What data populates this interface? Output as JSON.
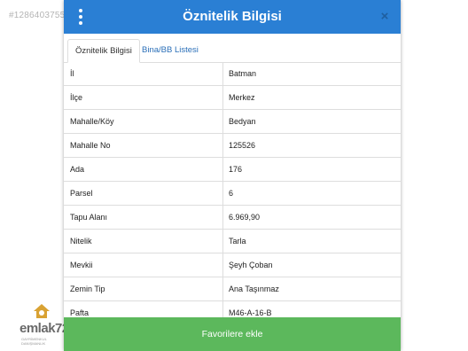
{
  "watermark": "#1286403755",
  "logo": {
    "brand": "emlak72",
    "tagline": "GAYRİMENKUL DANIŞMANLIK"
  },
  "modal": {
    "title": "Öznitelik Bilgisi",
    "close_glyph": "×",
    "tabs": [
      {
        "label": "Öznitelik Bilgisi",
        "active": true
      },
      {
        "label": "Bina/BB Listesi",
        "active": false
      }
    ],
    "rows": [
      {
        "key": "İl",
        "value": "Batman"
      },
      {
        "key": "İlçe",
        "value": "Merkez"
      },
      {
        "key": "Mahalle/Köy",
        "value": "Bedyan"
      },
      {
        "key": "Mahalle No",
        "value": "125526"
      },
      {
        "key": "Ada",
        "value": "176"
      },
      {
        "key": "Parsel",
        "value": "6"
      },
      {
        "key": "Tapu Alanı",
        "value": "6.969,90"
      },
      {
        "key": "Nitelik",
        "value": "Tarla"
      },
      {
        "key": "Mevkii",
        "value": "Şeyh Çoban"
      },
      {
        "key": "Zemin Tip",
        "value": "Ana Taşınmaz"
      },
      {
        "key": "Pafta",
        "value": "M46-A-16-B"
      }
    ],
    "favorite_button": "Favorilere ekle"
  },
  "colors": {
    "header": "#2a7fd4",
    "button": "#5cb85c",
    "link": "#2a6fb8"
  }
}
